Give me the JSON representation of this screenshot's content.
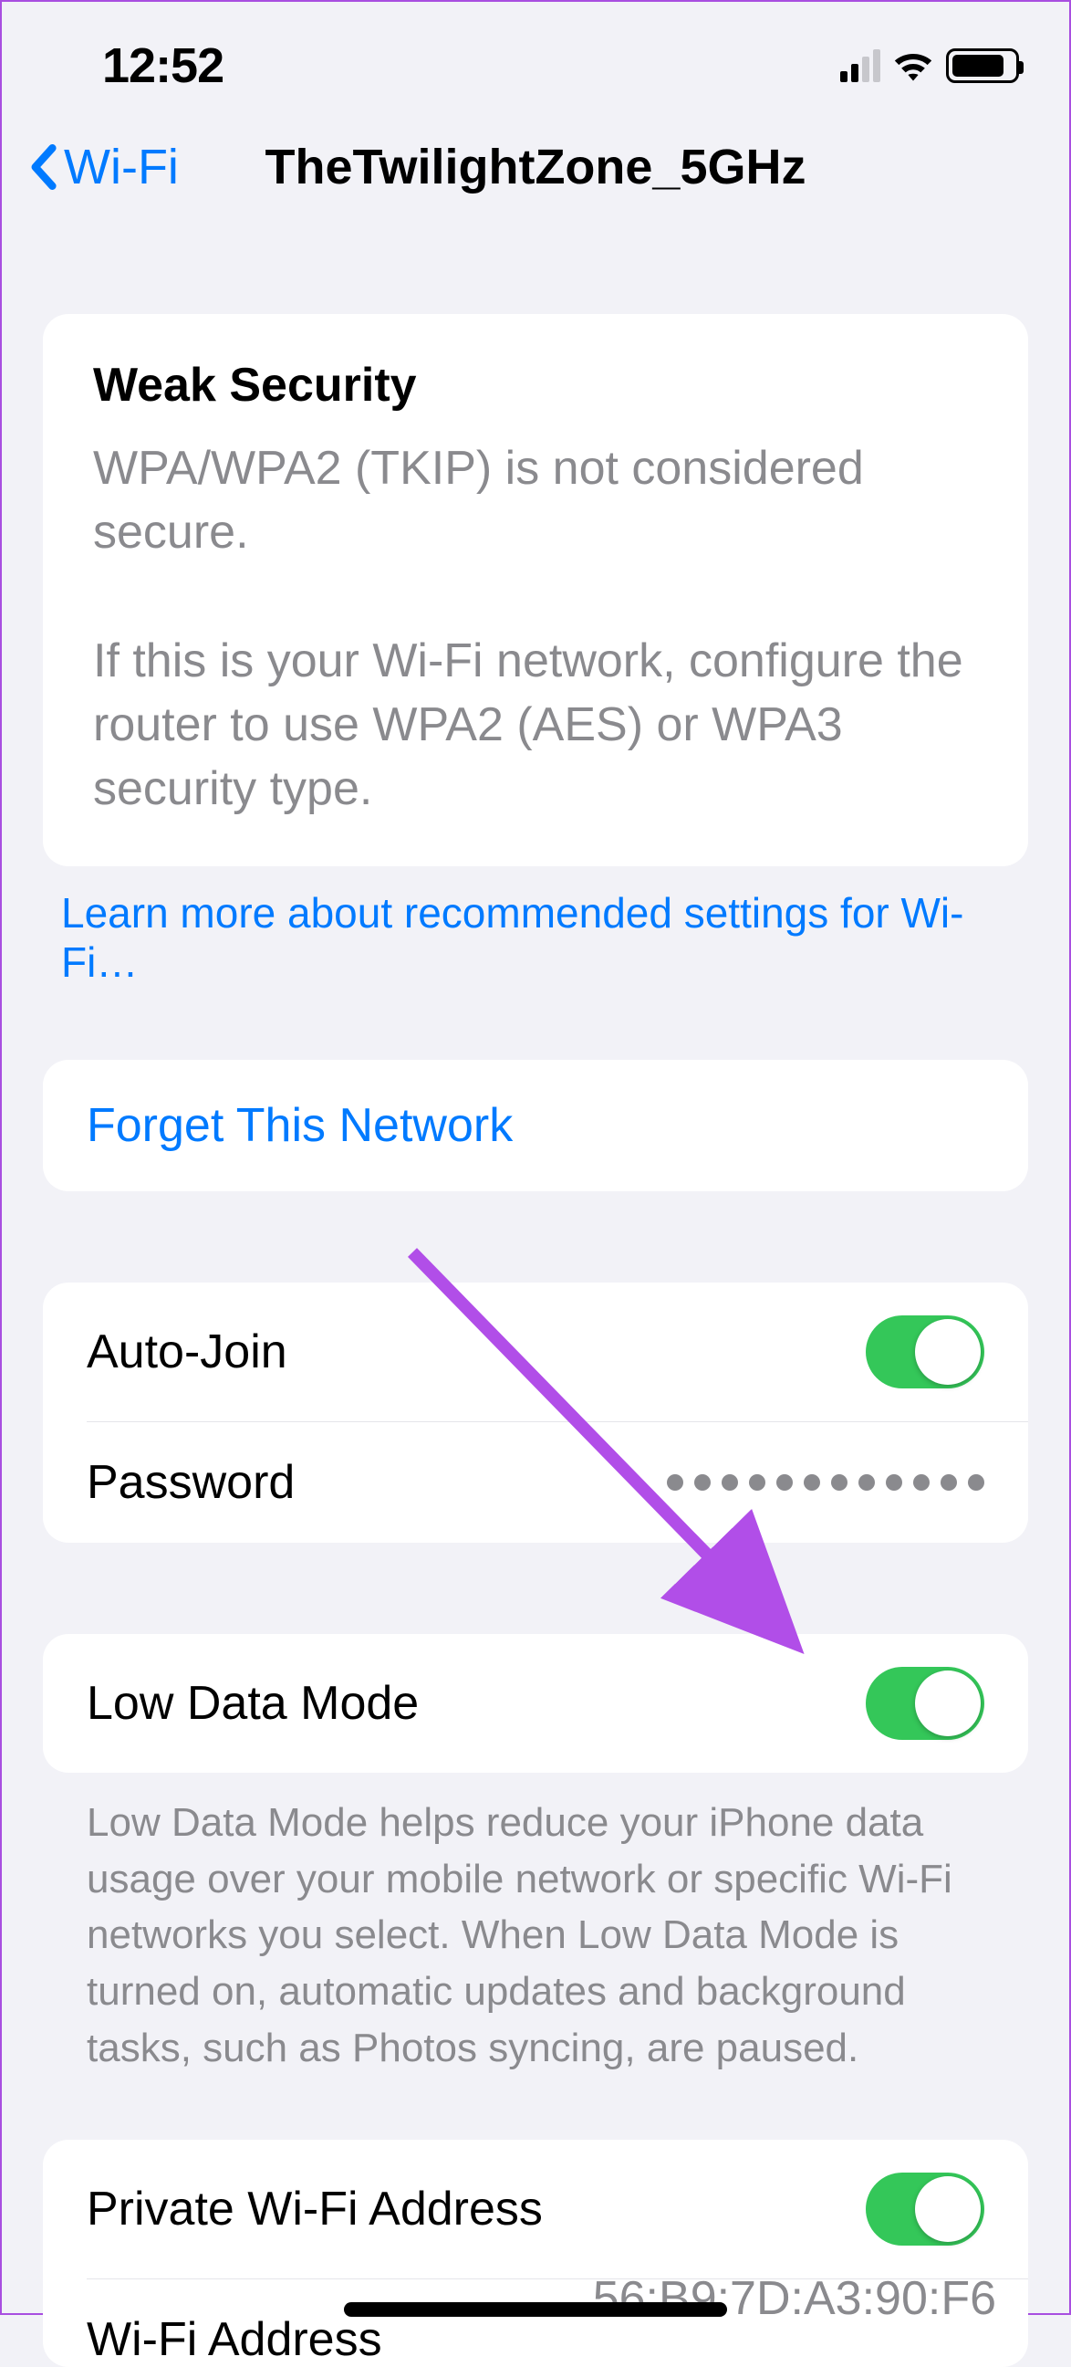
{
  "status": {
    "time": "12:52"
  },
  "nav": {
    "back": "Wi-Fi",
    "title": "TheTwilightZone_5GHz"
  },
  "security": {
    "heading": "Weak Security",
    "body": "WPA/WPA2 (TKIP) is not considered secure.\n\nIf this is your Wi-Fi network, configure the router to use WPA2 (AES) or WPA3 security type."
  },
  "learnMore": "Learn more about recommended settings for Wi-Fi…",
  "forget": "Forget This Network",
  "rows": {
    "autoJoin": "Auto-Join",
    "password": "Password",
    "passwordValue": "••••••••••••",
    "lowData": "Low Data Mode",
    "privateAddr": "Private Wi-Fi Address",
    "wifiAddr": "Wi-Fi Address",
    "wifiAddrValue": "56:B9:7D:A3:90:F6"
  },
  "lowDataFooter": "Low Data Mode helps reduce your iPhone data usage over your mobile network or specific Wi-Fi networks you select. When Low Data Mode is turned on, automatic updates and background tasks, such as Photos syncing, are paused.",
  "toggles": {
    "autoJoin": true,
    "lowData": true,
    "privateAddr": true
  }
}
